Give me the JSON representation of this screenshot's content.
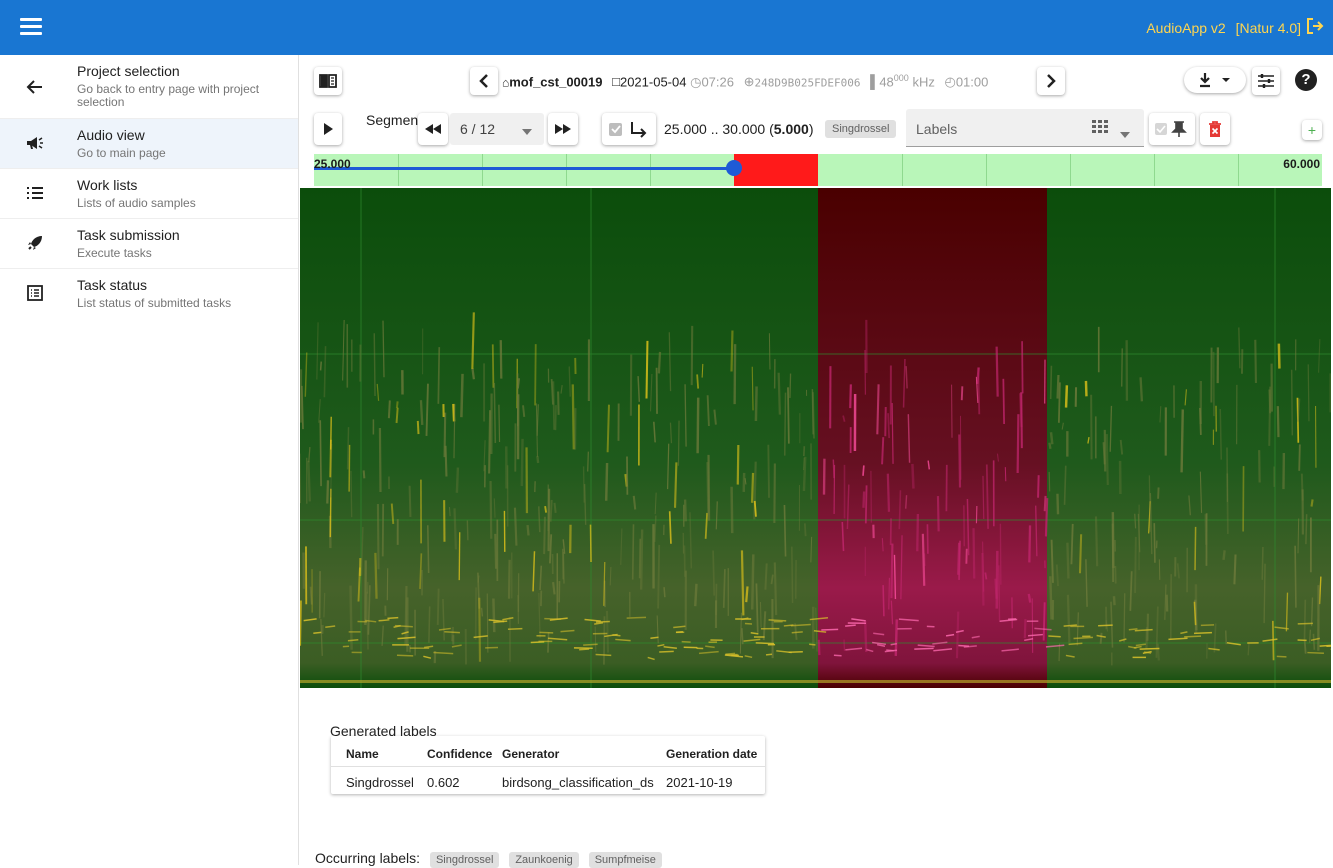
{
  "app": {
    "title": "AudioApp v2",
    "version": "[Natur 4.0]"
  },
  "sidebar": {
    "items": [
      {
        "title": "Project selection",
        "subtitle": "Go back to entry page with project selection",
        "icon": "arrow-left-icon"
      },
      {
        "title": "Audio view",
        "subtitle": "Go to main page",
        "icon": "megaphone-icon"
      },
      {
        "title": "Work lists",
        "subtitle": "Lists of audio samples",
        "icon": "list-icon"
      },
      {
        "title": "Task submission",
        "subtitle": "Execute tasks",
        "icon": "rocket-icon"
      },
      {
        "title": "Task status",
        "subtitle": "List status of submitted tasks",
        "icon": "list-alt-icon"
      }
    ]
  },
  "header": {
    "sample_name": "mof_cst_00019",
    "date": "2021-05-04",
    "time": "07:26",
    "device_id": "248D9B025FDEF006",
    "sample_rate": "48",
    "sample_rate_sup": "000",
    "sample_rate_unit": "kHz",
    "duration": "01:00"
  },
  "segment": {
    "label": "Segment",
    "position": "6 / 12",
    "range_text": "25.000 .. 30.000 (",
    "range_length": "5.000",
    "range_close": ")",
    "species_chip": "Singdrossel",
    "labels_placeholder": "Labels"
  },
  "timeline": {
    "start": "25.000",
    "end": "60.000",
    "position_fraction": 0.4167,
    "selection_start": 25.0,
    "selection_end": 30.0
  },
  "generated_labels": {
    "title": "Generated labels",
    "columns": [
      "Name",
      "Confidence",
      "Generator",
      "Generation date"
    ],
    "rows": [
      [
        "Singdrossel",
        "0.602",
        "birdsong_classification_ds",
        "2021-10-19"
      ]
    ]
  },
  "occurring_labels": {
    "label": "Occurring labels:",
    "chips": [
      "Singdrossel",
      "Zaunkoenig",
      "Sumpfmeise"
    ]
  },
  "colors": {
    "topbar": "#1976d2",
    "accent": "#ffd54f",
    "spectrogram_bg": "#0b4d0b",
    "selection": "#4a0000",
    "timeline_bg": "#b9f6b9"
  }
}
